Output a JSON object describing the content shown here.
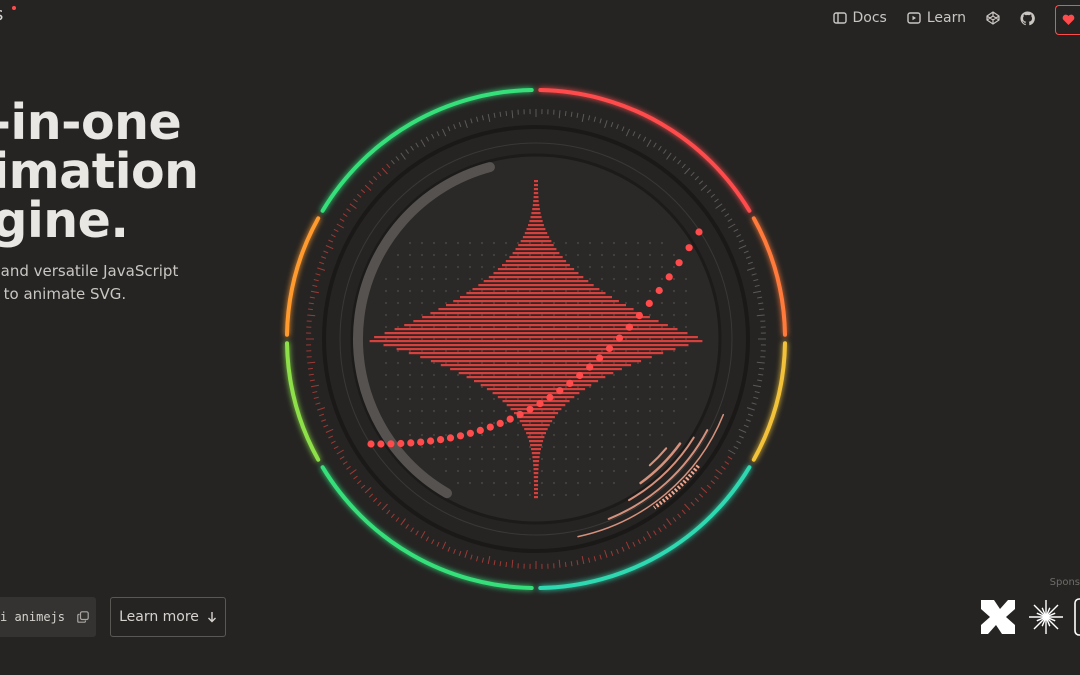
{
  "header": {
    "logo_text": "s",
    "nav": [
      {
        "label": "Docs",
        "icon": "book-icon"
      },
      {
        "label": "Learn",
        "icon": "play-icon"
      }
    ],
    "icons": [
      "codepen-icon",
      "github-icon",
      "heart-icon"
    ]
  },
  "hero": {
    "title_lines": [
      "ll-in-one",
      "nimation",
      "ngine."
    ],
    "subtitle_lines": [
      "t and versatile JavaScript",
      "y to animate SVG."
    ]
  },
  "cta": {
    "install_command": "i animejs",
    "learn_more": "Learn more"
  },
  "sponsors": {
    "label": "Spons"
  },
  "colors": {
    "accent": "#ff4b4b",
    "background": "#252423",
    "ring_gradient": [
      "#ff4b4b",
      "#ff9a2e",
      "#f2c23a",
      "#36e07a",
      "#22d3c5"
    ]
  }
}
